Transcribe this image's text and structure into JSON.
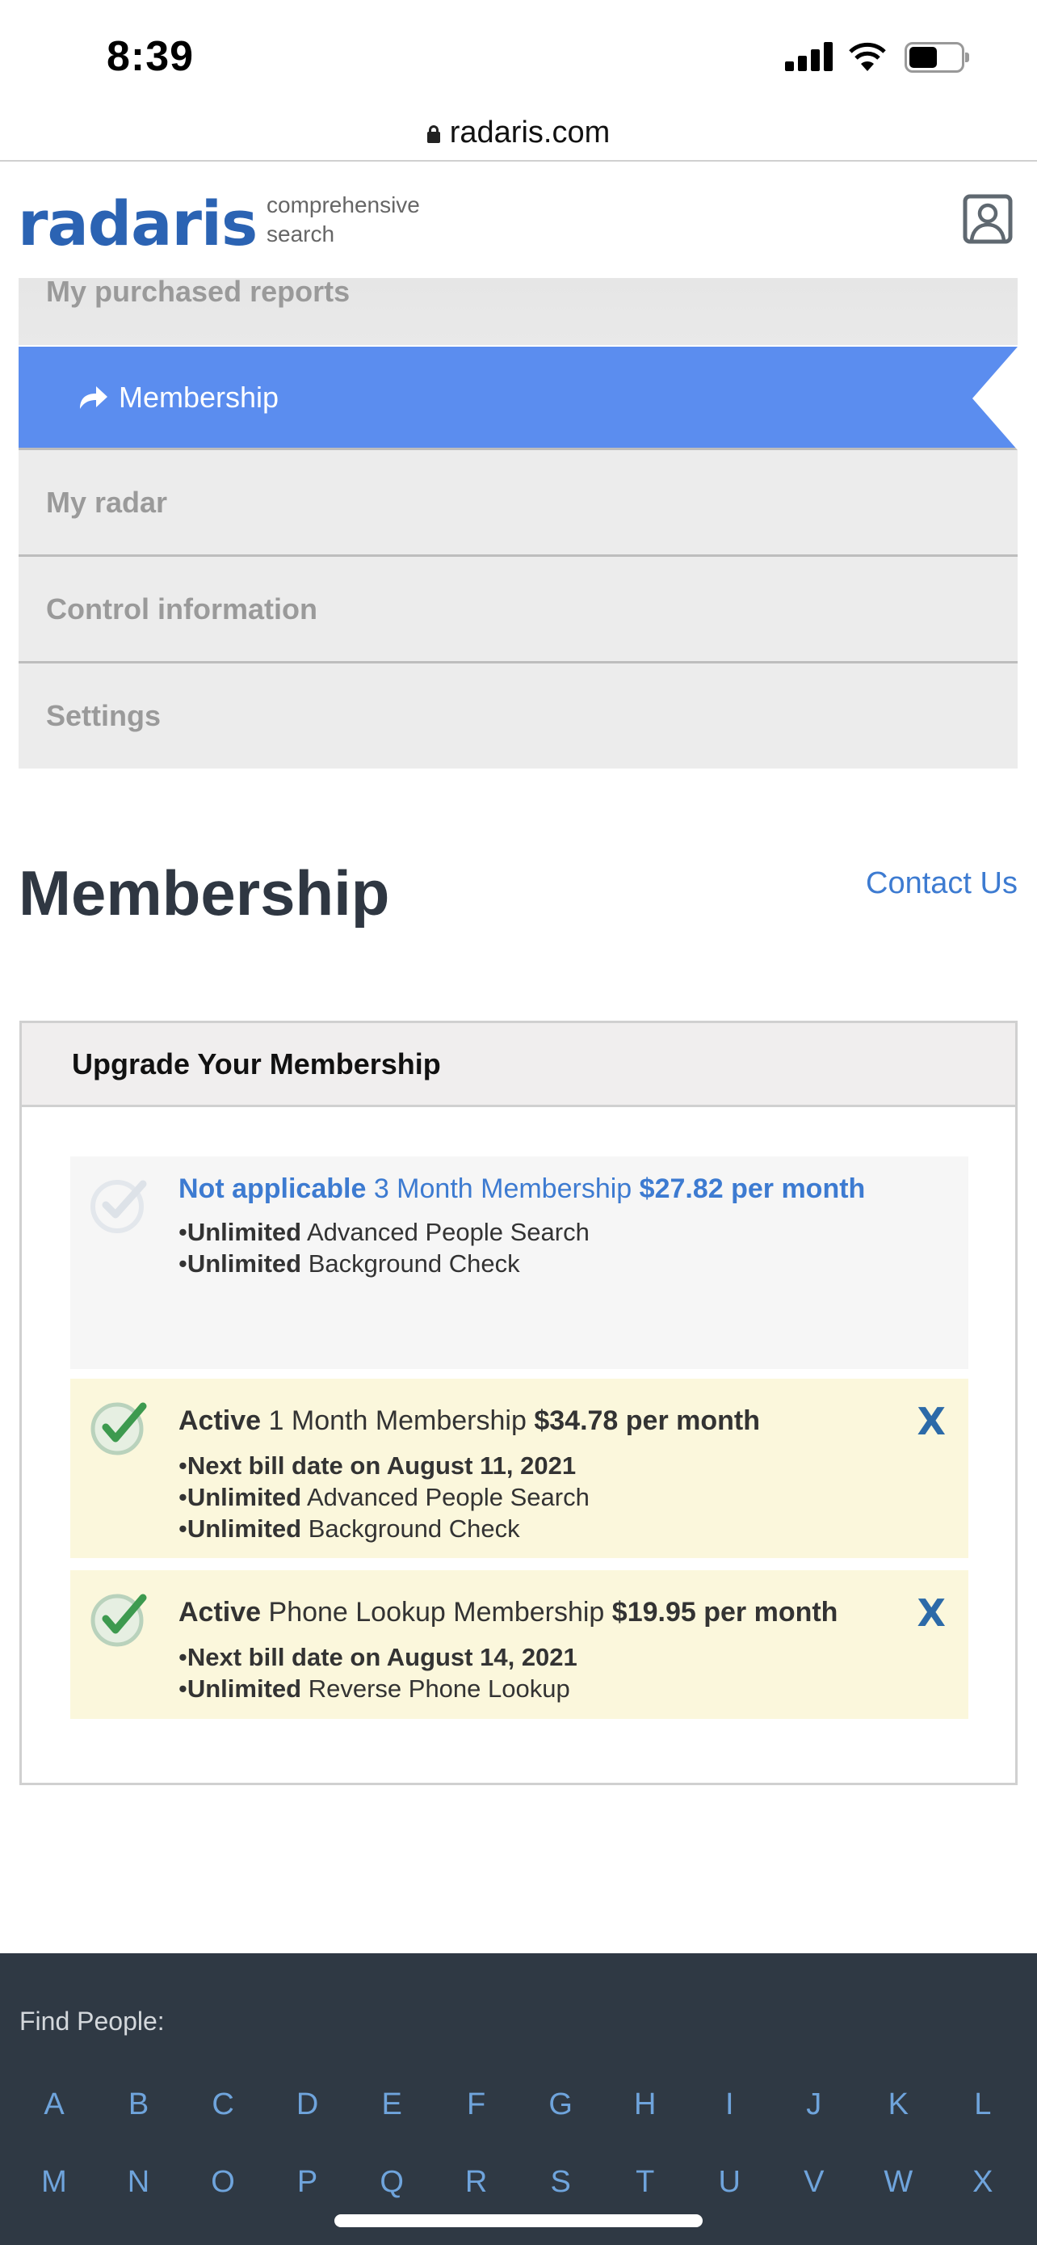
{
  "status_bar": {
    "time": "8:39"
  },
  "browser": {
    "url": "radaris.com"
  },
  "header": {
    "logo": "radaris",
    "tagline_line1": "comprehensive",
    "tagline_line2": "search"
  },
  "menu": {
    "items": [
      {
        "label": "My purchased reports",
        "active": false
      },
      {
        "label": "Membership",
        "active": true
      },
      {
        "label": "My radar",
        "active": false
      },
      {
        "label": "Control information",
        "active": false
      },
      {
        "label": "Settings",
        "active": false
      }
    ]
  },
  "page": {
    "title": "Membership",
    "contact_link": "Contact Us"
  },
  "panel": {
    "title": "Upgrade Your Membership",
    "plans": [
      {
        "status": "Not applicable",
        "name": "3 Month Membership",
        "price": "$27.82 per month",
        "features": [
          {
            "bold": "Unlimited",
            "text": "Advanced People Search"
          },
          {
            "bold": "Unlimited",
            "text": "Background Check"
          }
        ]
      },
      {
        "status": "Active",
        "name": "1 Month Membership",
        "price": "$34.78 per month",
        "next_bill": "Next bill date on August 11, 2021",
        "features": [
          {
            "bold": "Unlimited",
            "text": "Advanced People Search"
          },
          {
            "bold": "Unlimited",
            "text": "Background Check"
          }
        ],
        "cancel_label": "X"
      },
      {
        "status": "Active",
        "name": "Phone Lookup Membership",
        "price": "$19.95 per month",
        "next_bill": "Next bill date on August 14, 2021",
        "features": [
          {
            "bold": "Unlimited",
            "text": "Reverse Phone Lookup"
          }
        ],
        "cancel_label": "X"
      }
    ]
  },
  "footer": {
    "find_label": "Find People:",
    "row1": [
      "A",
      "B",
      "C",
      "D",
      "E",
      "F",
      "G",
      "H",
      "I",
      "J",
      "K",
      "L"
    ],
    "row2": [
      "M",
      "N",
      "O",
      "P",
      "Q",
      "R",
      "S",
      "T",
      "U",
      "V",
      "W",
      "X"
    ]
  },
  "colors": {
    "brand_blue": "#2b63b3",
    "active_menu": "#5b8def",
    "link_blue": "#3d7bd1",
    "active_plan_bg": "#fbf7dc",
    "check_green": "#3d9a4f",
    "footer_bg": "#2f3944"
  }
}
